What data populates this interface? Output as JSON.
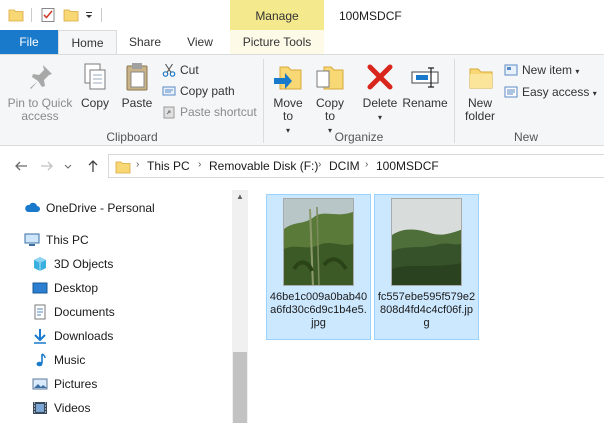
{
  "titlebar": {
    "context_tab": "Manage",
    "window_title": "100MSDCF"
  },
  "tabs": {
    "file": "File",
    "home": "Home",
    "share": "Share",
    "view": "View",
    "picture_tools": "Picture Tools"
  },
  "ribbon": {
    "clipboard": {
      "label": "Clipboard",
      "pin": "Pin to Quick access",
      "copy": "Copy",
      "paste": "Paste",
      "cut": "Cut",
      "copy_path": "Copy path",
      "paste_shortcut": "Paste shortcut"
    },
    "organize": {
      "label": "Organize",
      "move_to": "Move to",
      "copy_to": "Copy to",
      "delete": "Delete",
      "rename": "Rename"
    },
    "new": {
      "label": "New",
      "new_folder": "New folder",
      "new_item": "New item",
      "easy_access": "Easy access"
    }
  },
  "address": {
    "crumbs": [
      "This PC",
      "Removable Disk (F:)",
      "DCIM",
      "100MSDCF"
    ]
  },
  "navpane": {
    "items": [
      {
        "label": "OneDrive - Personal",
        "icon": "cloud-icon"
      },
      {
        "label": "This PC",
        "icon": "computer-icon"
      },
      {
        "label": "3D Objects",
        "icon": "cube-icon"
      },
      {
        "label": "Desktop",
        "icon": "desktop-icon"
      },
      {
        "label": "Documents",
        "icon": "document-icon"
      },
      {
        "label": "Downloads",
        "icon": "download-icon"
      },
      {
        "label": "Music",
        "icon": "music-icon"
      },
      {
        "label": "Pictures",
        "icon": "pictures-icon"
      },
      {
        "label": "Videos",
        "icon": "video-icon"
      }
    ]
  },
  "files": [
    {
      "name": "46be1c009a0bab40a6fd30c6d9c1b4e5.jpg"
    },
    {
      "name": "fc557ebe595f579e2808d4fd4c4cf06f.jpg"
    }
  ],
  "colors": {
    "accent": "#1979ca",
    "context_tab": "#f5e98e",
    "selection": "#cce8ff"
  }
}
